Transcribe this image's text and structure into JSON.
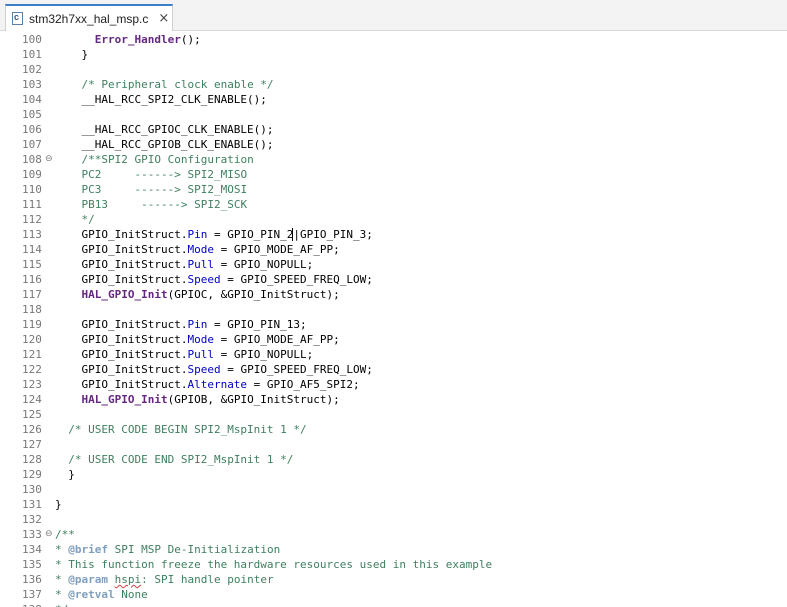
{
  "tab": {
    "icon": "c-file-icon",
    "icon_letter": "c",
    "label": "stm32h7xx_hal_msp.c",
    "close_icon": "close-icon",
    "close_glyph": "×"
  },
  "colors": {
    "comment": "#3f7f5f",
    "field": "#0000c0",
    "function": "#642880",
    "line_number": "#787878",
    "tab_accent": "#3c7fc6"
  },
  "lines": [
    {
      "n": "100",
      "segs": [
        [
          "      ",
          "default"
        ],
        [
          "Error_Handler",
          "func"
        ],
        [
          "();",
          "default"
        ]
      ]
    },
    {
      "n": "101",
      "segs": [
        [
          "    }",
          "default"
        ]
      ]
    },
    {
      "n": "102",
      "segs": []
    },
    {
      "n": "103",
      "segs": [
        [
          "    ",
          "default"
        ],
        [
          "/* Peripheral clock enable */",
          "comment"
        ]
      ]
    },
    {
      "n": "104",
      "segs": [
        [
          "    __HAL_RCC_SPI2_CLK_ENABLE();",
          "default"
        ]
      ]
    },
    {
      "n": "105",
      "segs": []
    },
    {
      "n": "106",
      "segs": [
        [
          "    __HAL_RCC_GPIOC_CLK_ENABLE();",
          "default"
        ]
      ]
    },
    {
      "n": "107",
      "segs": [
        [
          "    __HAL_RCC_GPIOB_CLK_ENABLE();",
          "default"
        ]
      ]
    },
    {
      "n": "108",
      "fold": "⊖",
      "segs": [
        [
          "    ",
          "default"
        ],
        [
          "/**SPI2 GPIO Configuration",
          "comment"
        ]
      ]
    },
    {
      "n": "109",
      "segs": [
        [
          "    ",
          "default"
        ],
        [
          "PC2     ------> SPI2_MISO",
          "comment"
        ]
      ]
    },
    {
      "n": "110",
      "segs": [
        [
          "    ",
          "default"
        ],
        [
          "PC3     ------> SPI2_MOSI",
          "comment"
        ]
      ]
    },
    {
      "n": "111",
      "segs": [
        [
          "    ",
          "default"
        ],
        [
          "PB13     ------> SPI2_SCK",
          "comment"
        ]
      ]
    },
    {
      "n": "112",
      "segs": [
        [
          "    ",
          "default"
        ],
        [
          "*/",
          "comment"
        ]
      ]
    },
    {
      "n": "113",
      "segs": [
        [
          "    GPIO_InitStruct.",
          "default"
        ],
        [
          "Pin",
          "field"
        ],
        [
          " = GPIO_PIN_2",
          "default"
        ],
        [
          "|",
          "caret"
        ],
        [
          "GPIO_PIN_3;",
          "default"
        ]
      ]
    },
    {
      "n": "114",
      "segs": [
        [
          "    GPIO_InitStruct.",
          "default"
        ],
        [
          "Mode",
          "field"
        ],
        [
          " = GPIO_MODE_AF_PP;",
          "default"
        ]
      ]
    },
    {
      "n": "115",
      "segs": [
        [
          "    GPIO_InitStruct.",
          "default"
        ],
        [
          "Pull",
          "field"
        ],
        [
          " = GPIO_NOPULL;",
          "default"
        ]
      ]
    },
    {
      "n": "116",
      "segs": [
        [
          "    GPIO_InitStruct.",
          "default"
        ],
        [
          "Speed",
          "field"
        ],
        [
          " = GPIO_SPEED_FREQ_LOW;",
          "default"
        ]
      ]
    },
    {
      "n": "117",
      "segs": [
        [
          "    ",
          "default"
        ],
        [
          "HAL_GPIO_Init",
          "func"
        ],
        [
          "(GPIOC, &GPIO_InitStruct);",
          "default"
        ]
      ]
    },
    {
      "n": "118",
      "segs": []
    },
    {
      "n": "119",
      "segs": [
        [
          "    GPIO_InitStruct.",
          "default"
        ],
        [
          "Pin",
          "field"
        ],
        [
          " = GPIO_PIN_13;",
          "default"
        ]
      ]
    },
    {
      "n": "120",
      "segs": [
        [
          "    GPIO_InitStruct.",
          "default"
        ],
        [
          "Mode",
          "field"
        ],
        [
          " = GPIO_MODE_AF_PP;",
          "default"
        ]
      ]
    },
    {
      "n": "121",
      "segs": [
        [
          "    GPIO_InitStruct.",
          "default"
        ],
        [
          "Pull",
          "field"
        ],
        [
          " = GPIO_NOPULL;",
          "default"
        ]
      ]
    },
    {
      "n": "122",
      "segs": [
        [
          "    GPIO_InitStruct.",
          "default"
        ],
        [
          "Speed",
          "field"
        ],
        [
          " = GPIO_SPEED_FREQ_LOW;",
          "default"
        ]
      ]
    },
    {
      "n": "123",
      "segs": [
        [
          "    GPIO_InitStruct.",
          "default"
        ],
        [
          "Alternate",
          "field"
        ],
        [
          " = GPIO_AF5_SPI2;",
          "default"
        ]
      ]
    },
    {
      "n": "124",
      "segs": [
        [
          "    ",
          "default"
        ],
        [
          "HAL_GPIO_Init",
          "func"
        ],
        [
          "(GPIOB, &GPIO_InitStruct);",
          "default"
        ]
      ]
    },
    {
      "n": "125",
      "segs": []
    },
    {
      "n": "126",
      "segs": [
        [
          "  ",
          "default"
        ],
        [
          "/* USER CODE BEGIN SPI2_MspInit 1 */",
          "comment"
        ]
      ]
    },
    {
      "n": "127",
      "segs": []
    },
    {
      "n": "128",
      "segs": [
        [
          "  ",
          "default"
        ],
        [
          "/* USER CODE END SPI2_MspInit 1 */",
          "comment"
        ]
      ]
    },
    {
      "n": "129",
      "segs": [
        [
          "  }",
          "default"
        ]
      ]
    },
    {
      "n": "130",
      "segs": []
    },
    {
      "n": "131",
      "segs": [
        [
          "}",
          "default"
        ]
      ]
    },
    {
      "n": "132",
      "segs": []
    },
    {
      "n": "133",
      "fold": "⊖",
      "segs": [
        [
          "/**",
          "comment"
        ]
      ]
    },
    {
      "n": "134",
      "segs": [
        [
          "* ",
          "comment"
        ],
        [
          "@brief",
          "tag"
        ],
        [
          " SPI MSP De-Initialization",
          "comment"
        ]
      ]
    },
    {
      "n": "135",
      "segs": [
        [
          "* This function freeze the hardware resources used in this example",
          "comment"
        ]
      ]
    },
    {
      "n": "136",
      "segs": [
        [
          "* ",
          "comment"
        ],
        [
          "@param",
          "tag"
        ],
        [
          " ",
          "comment"
        ],
        [
          "hspi",
          "spell"
        ],
        [
          ": SPI handle pointer",
          "comment"
        ]
      ]
    },
    {
      "n": "137",
      "segs": [
        [
          "* ",
          "comment"
        ],
        [
          "@retval",
          "tag"
        ],
        [
          " None",
          "comment"
        ]
      ]
    },
    {
      "n": "138",
      "segs": [
        [
          "*/",
          "comment"
        ]
      ]
    }
  ]
}
